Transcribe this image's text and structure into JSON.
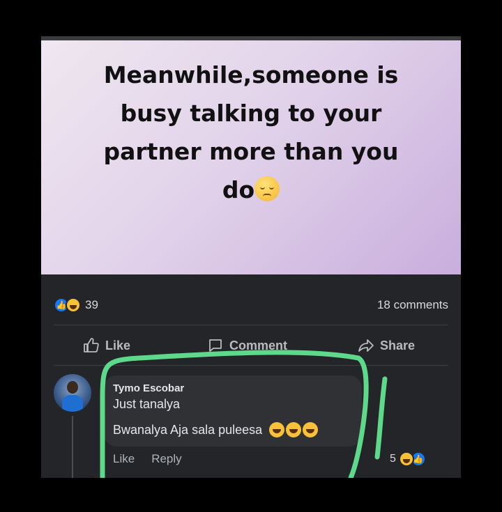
{
  "post": {
    "text_line1": "Meanwhile,someone is",
    "text_line2": "busy talking to your",
    "text_line3": "partner more than you",
    "text_line4": "do",
    "background_colors": [
      "#efe7f0",
      "#c9aedd"
    ]
  },
  "stats": {
    "reaction_count": "39",
    "comments_count": "18 comments",
    "reaction_icons": [
      "like-icon",
      "haha-icon"
    ]
  },
  "actions": {
    "like_label": "Like",
    "comment_label": "Comment",
    "share_label": "Share"
  },
  "comment": {
    "author": "Tymo Escobar",
    "line1": "Just tanalya",
    "line2": "Bwanalya Aja sala puleesa",
    "like_label": "Like",
    "reply_label": "Reply",
    "reaction_count": "5",
    "reaction_icons": [
      "haha-icon",
      "like-icon"
    ]
  },
  "colors": {
    "accent": "#1877f2",
    "highlight_stroke": "#5ed88a",
    "card_bg": "#232528"
  }
}
